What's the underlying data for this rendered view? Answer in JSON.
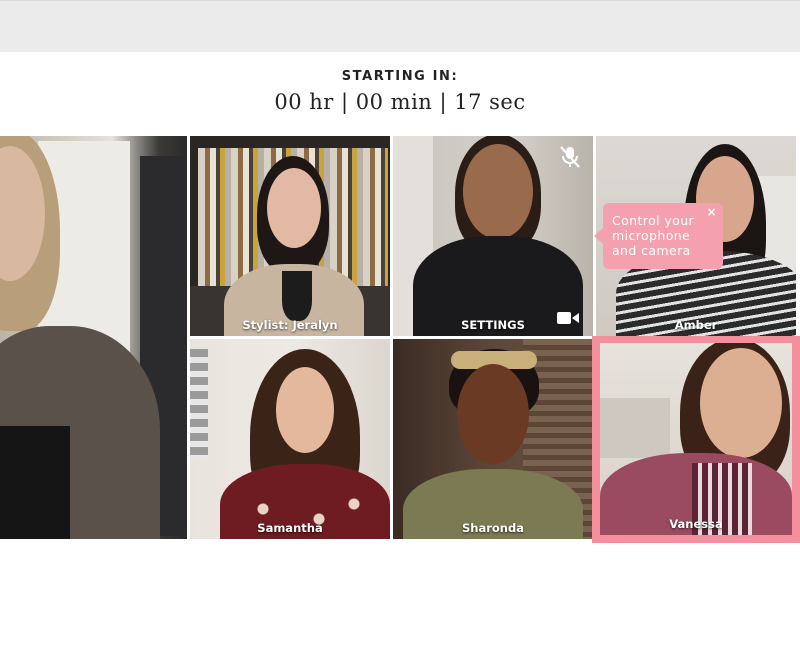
{
  "countdown": {
    "label": "STARTING IN:",
    "value": "00 hr | 00 min | 17 sec"
  },
  "tiles": [
    {
      "id": "host",
      "name": ""
    },
    {
      "id": "stylist",
      "name": "Stylist: Jeralyn"
    },
    {
      "id": "self",
      "name": "SETTINGS",
      "mic_icon": "mic-muted-icon",
      "camera_icon": "video-camera-icon"
    },
    {
      "id": "amber",
      "name": "Amber"
    },
    {
      "id": "samantha",
      "name": "Samantha"
    },
    {
      "id": "sharonda",
      "name": "Sharonda"
    },
    {
      "id": "vanessa",
      "name": "Vanessa",
      "active": true
    }
  ],
  "tooltip": {
    "text": "Control your microphone and camera",
    "close_symbol": "×"
  },
  "colors": {
    "accent_pink": "#f48f9e",
    "topbar": "#ebebeb"
  }
}
